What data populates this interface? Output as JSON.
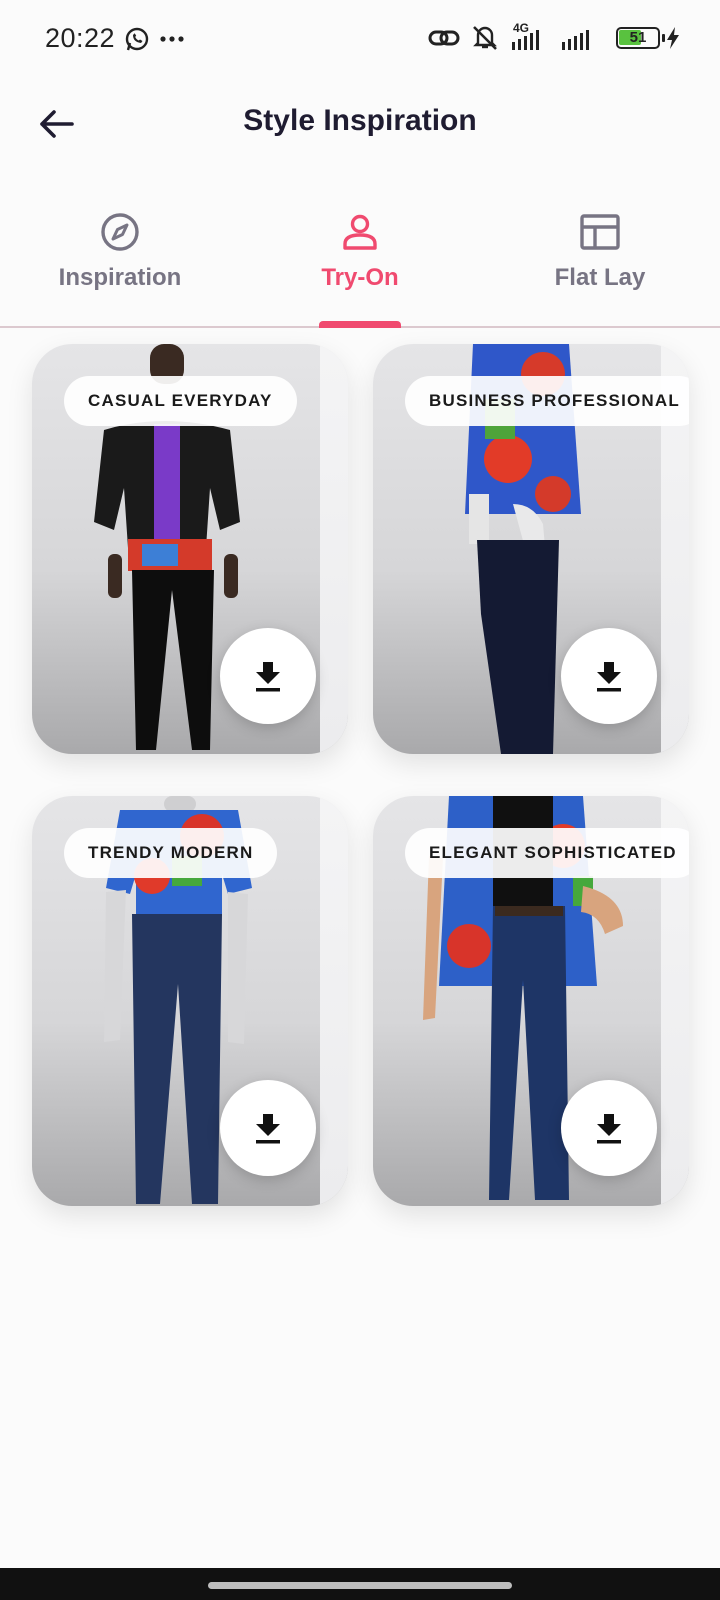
{
  "status_bar": {
    "time": "20:22",
    "network": "4G",
    "battery": "51",
    "icons": [
      "whatsapp-icon",
      "more-dots-icon",
      "link-icon",
      "mute-icon",
      "signal-icon",
      "battery-icon",
      "charging-icon"
    ]
  },
  "app_bar": {
    "title": "Style Inspiration",
    "back_icon": "arrow-left-icon"
  },
  "tabs": [
    {
      "label": "Inspiration",
      "icon": "compass-icon",
      "active": false
    },
    {
      "label": "Try-On",
      "icon": "person-icon",
      "active": true
    },
    {
      "label": "Flat Lay",
      "icon": "layout-icon",
      "active": false
    }
  ],
  "cards": [
    {
      "label": "CASUAL EVERYDAY",
      "action_icon": "download-icon"
    },
    {
      "label": "BUSINESS PROFESSIONAL",
      "action_icon": "download-icon"
    },
    {
      "label": "TRENDY MODERN",
      "action_icon": "download-icon"
    },
    {
      "label": "ELEGANT SOPHISTICATED",
      "action_icon": "download-icon"
    }
  ],
  "colors": {
    "accent": "#f04a6f",
    "inactive_tab": "#777483",
    "title": "#1f1c31",
    "background": "#fbfbfb"
  }
}
